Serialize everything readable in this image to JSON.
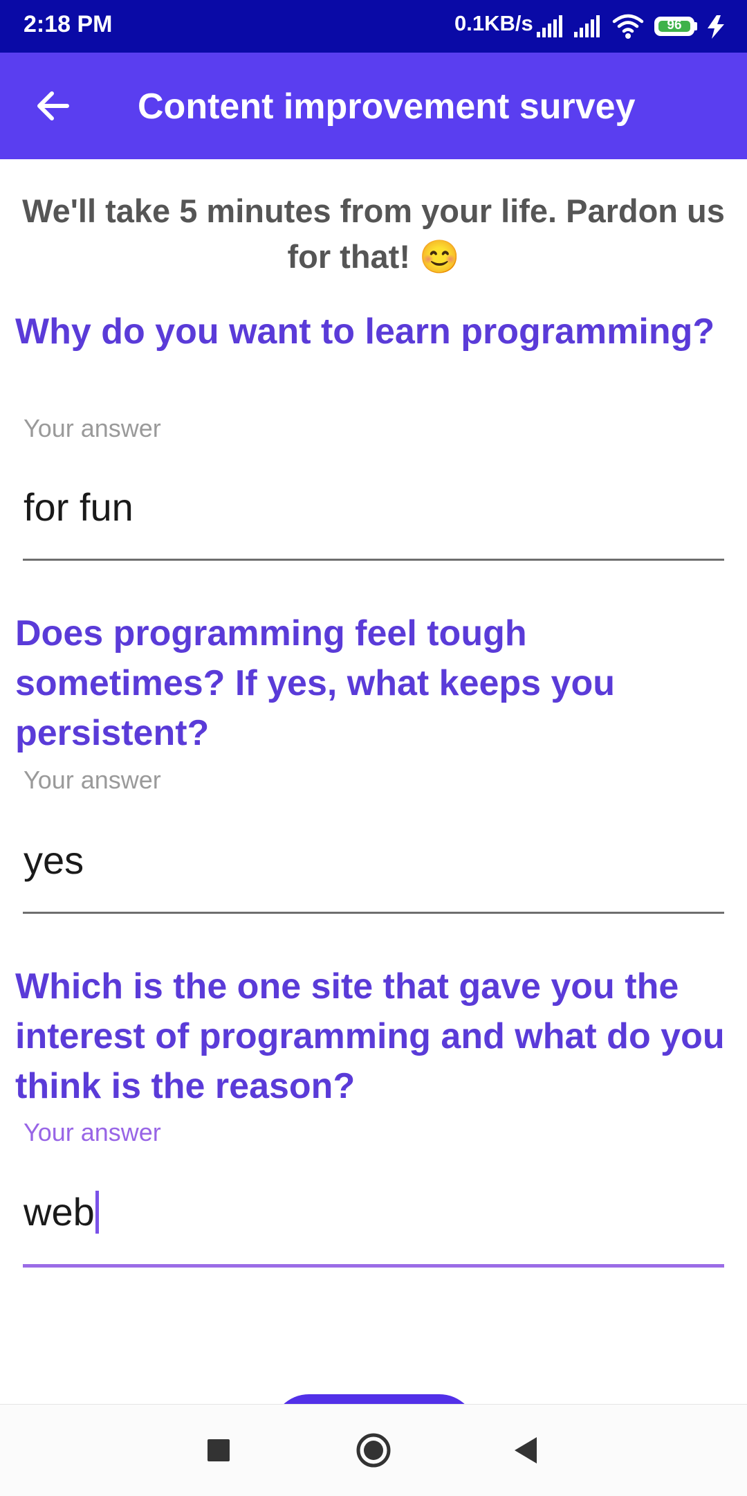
{
  "status_bar": {
    "time": "2:18 PM",
    "network_speed": "0.1KB/s",
    "battery": "96"
  },
  "app_bar": {
    "title": "Content improvement survey",
    "back_icon": "arrow-left-icon"
  },
  "intro": {
    "text": "We'll take 5 minutes from your life. Pardon us for that! 😊"
  },
  "questions": [
    {
      "question": "Why do you want to learn programming?",
      "placeholder": "Your answer",
      "answer": "for fun"
    },
    {
      "question": "Does programming feel tough sometimes? If yes, what keeps you persistent?",
      "placeholder": "Your answer",
      "answer": "yes"
    },
    {
      "question": "Which is the one site that gave you the interest of programming and what do you think is the reason?",
      "placeholder": "Your answer",
      "answer": "web"
    }
  ],
  "colors": {
    "status_bar": "#0a0aa6",
    "app_bar": "#5a3ef0",
    "question_text": "#5a3bd8",
    "active_field": "#9b6ce6"
  },
  "nav_bar": {
    "icons": [
      "square-recents-icon",
      "circle-home-icon",
      "triangle-back-icon"
    ]
  }
}
